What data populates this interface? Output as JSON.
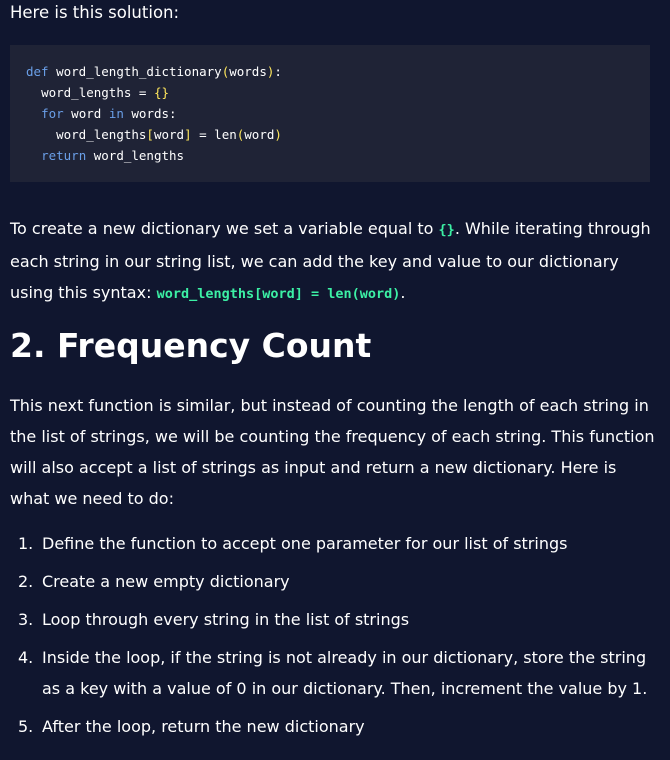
{
  "intro": "Here is this solution:",
  "code": {
    "line1": {
      "kw": "def",
      "fn": "word_length_dictionary",
      "open": "(",
      "arg": "words",
      "close": ")",
      "colon": ":"
    },
    "line2": {
      "var": "word_lengths",
      "op": " = ",
      "val": "{}"
    },
    "line3": {
      "kw1": "for",
      "var": "word",
      "kw2": "in",
      "iter": "words",
      "colon": ":"
    },
    "line4": {
      "target": "word_lengths",
      "lb": "[",
      "key": "word",
      "rb": "]",
      "op": " = ",
      "call": "len",
      "open": "(",
      "arg": "word",
      "close": ")"
    },
    "line5": {
      "kw": "return",
      "var": "word_lengths"
    }
  },
  "paragraph1": {
    "part1": "To create a new dictionary we set a variable equal to ",
    "code1": "{}",
    "part2": ". While iterating through each string in our string list, we can add the key and value to our dictionary using this syntax: ",
    "code2": "word_lengths[word] = len(word)",
    "part3": "."
  },
  "heading": "2. Frequency Count",
  "paragraph2": "This next function is similar, but instead of counting the length of each string in the list of strings, we will be counting the frequency of each string. This function will also accept a list of strings as input and return a new dictionary. Here is what we need to do:",
  "steps": [
    {
      "num": "1.",
      "text": "Define the function to accept one parameter for our list of strings"
    },
    {
      "num": "2.",
      "text": "Create a new empty dictionary"
    },
    {
      "num": "3.",
      "text": "Loop through every string in the list of strings"
    },
    {
      "num": "4.",
      "text": "Inside the loop, if the string is not already in our dictionary, store the string as a key with a value of 0 in our dictionary. Then, increment the value by 1."
    },
    {
      "num": "5.",
      "text": "After the loop, return the new dictionary"
    }
  ]
}
